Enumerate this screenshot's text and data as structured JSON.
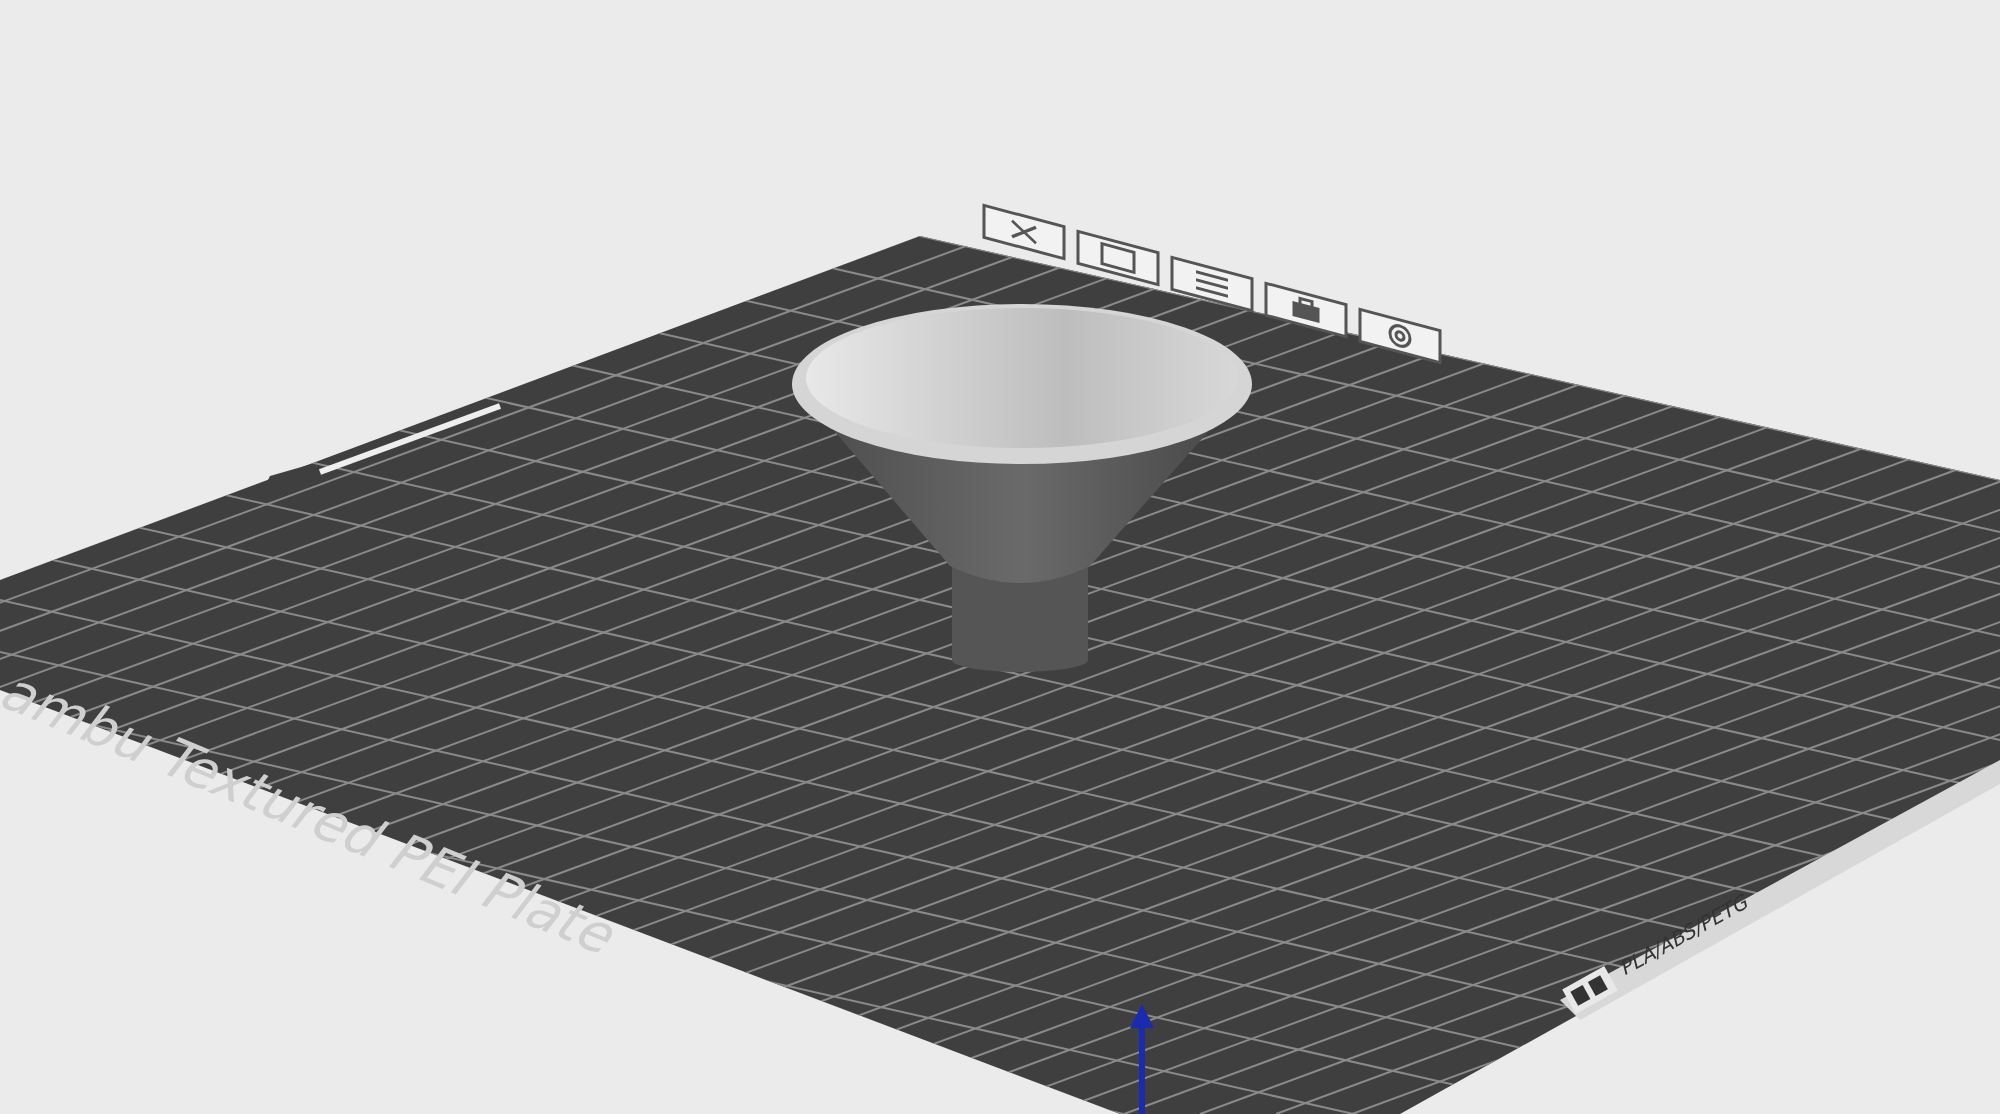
{
  "plate": {
    "name": "ambu Textured PEI Plate",
    "materials": "PLA/ABS/PETG"
  }
}
